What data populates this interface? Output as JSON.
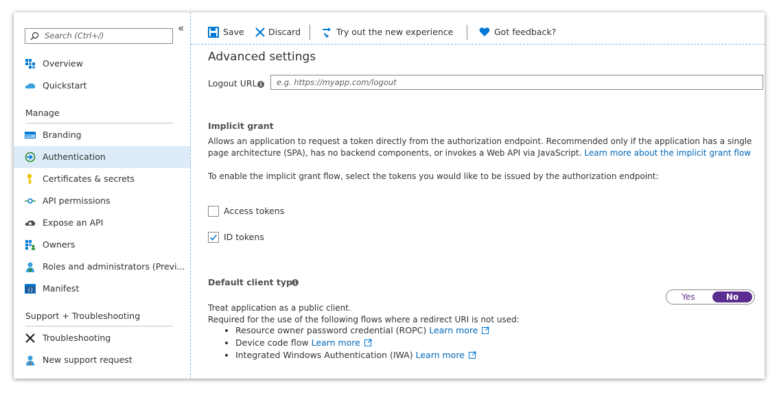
{
  "sidebar": {
    "search_placeholder": "Search (Ctrl+/)",
    "collapse_glyph": "«",
    "top_items": [
      {
        "label": "Overview",
        "icon": "grid-blocks-icon"
      },
      {
        "label": "Quickstart",
        "icon": "cloud-icon"
      }
    ],
    "manage_title": "Manage",
    "manage_items": [
      {
        "label": "Branding",
        "icon": "branding-icon"
      },
      {
        "label": "Authentication",
        "icon": "authentication-icon",
        "active": true
      },
      {
        "label": "Certificates & secrets",
        "icon": "key-icon"
      },
      {
        "label": "API permissions",
        "icon": "api-permissions-icon"
      },
      {
        "label": "Expose an API",
        "icon": "cloud-gear-icon"
      },
      {
        "label": "Owners",
        "icon": "owners-icon"
      },
      {
        "label": "Roles and administrators (Previ...",
        "icon": "roles-icon"
      },
      {
        "label": "Manifest",
        "icon": "manifest-icon"
      }
    ],
    "support_title": "Support + Troubleshooting",
    "support_items": [
      {
        "label": "Troubleshooting",
        "icon": "wrench-icon"
      },
      {
        "label": "New support request",
        "icon": "support-person-icon"
      }
    ]
  },
  "toolbar": {
    "save_label": "Save",
    "discard_label": "Discard",
    "try_label": "Try out the new experience",
    "feedback_label": "Got feedback?"
  },
  "content": {
    "advanced_title": "Advanced settings",
    "logout_label": "Logout URL",
    "logout_placeholder": "e.g. https://myapp.com/logout",
    "implicit_title": "Implicit grant",
    "implicit_desc": "Allows an application to request a token directly from the authorization endpoint. Recommended only if the application has a single page architecture (SPA), has no backend components, or invokes a Web API via JavaScript.",
    "implicit_link": "Learn more about the implicit grant flow",
    "enable_text": "To enable the implicit grant flow, select the tokens you would like to be issued by the authorization endpoint:",
    "access_tokens_label": "Access tokens",
    "access_tokens_checked": false,
    "id_tokens_label": "ID tokens",
    "id_tokens_checked": true,
    "client_type_title": "Default client type",
    "public_client_line1": "Treat application as a public client.",
    "public_client_line2": "Required for the use of the following flows where a redirect URI is not used:",
    "toggle_yes": "Yes",
    "toggle_no": "No",
    "toggle_selected": "No",
    "flows": [
      {
        "text": "Resource owner password credential (ROPC)",
        "link": "Learn more"
      },
      {
        "text": "Device code flow",
        "link": "Learn more"
      },
      {
        "text": "Integrated Windows Authentication (IWA)",
        "link": "Learn more"
      }
    ]
  },
  "colors": {
    "accent_blue": "#0067b8",
    "active_nav": "#dcebf7",
    "toggle_purple": "#5c2d91"
  }
}
